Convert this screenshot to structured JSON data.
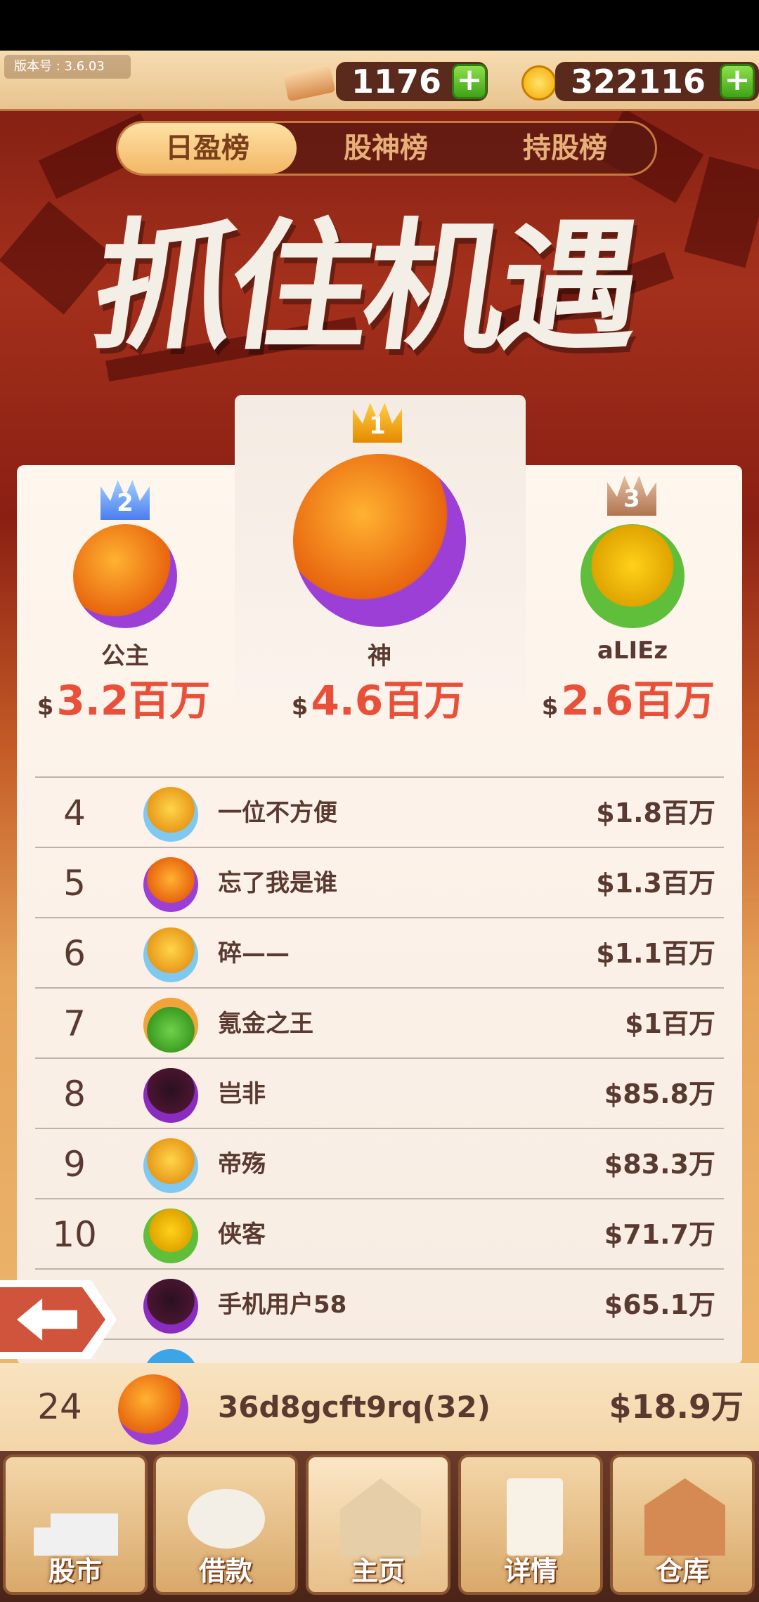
{
  "header": {
    "version_label": "版本号",
    "version_value": "3.6.03",
    "ticket_count": "1176",
    "coin_count": "322116",
    "plus": "+"
  },
  "tabs": [
    "日盈榜",
    "股神榜",
    "持股榜"
  ],
  "active_tab": 0,
  "banner_title": "抓住机遇",
  "podium": [
    {
      "rank": "1",
      "name": "神",
      "currency": "$",
      "value": "4.6百万"
    },
    {
      "rank": "2",
      "name": "公主",
      "currency": "$",
      "value": "3.2百万"
    },
    {
      "rank": "3",
      "name": "aLIEz",
      "currency": "$",
      "value": "2.6百万"
    }
  ],
  "list": [
    {
      "rank": "4",
      "name": "一位不方便",
      "value": "$1.8百万"
    },
    {
      "rank": "5",
      "name": "忘了我是谁",
      "value": "$1.3百万"
    },
    {
      "rank": "6",
      "name": "碎——",
      "value": "$1.1百万"
    },
    {
      "rank": "7",
      "name": "氪金之王",
      "value": "$1百万"
    },
    {
      "rank": "8",
      "name": "岂非",
      "value": "$85.8万"
    },
    {
      "rank": "9",
      "name": "帝殇",
      "value": "$83.3万"
    },
    {
      "rank": "10",
      "name": "侠客",
      "value": "$71.7万"
    },
    {
      "rank": "",
      "name": "手机用户58",
      "value": "$65.1万"
    }
  ],
  "my_row": {
    "rank": "24",
    "name": "36d8gcft9rq(32)",
    "value": "$18.9万"
  },
  "nav": [
    "股市",
    "借款",
    "主页",
    "详情",
    "仓库"
  ],
  "colors": {
    "accent": "#e8503a",
    "text": "#5a3a30",
    "tab_active": "#f2b766"
  }
}
